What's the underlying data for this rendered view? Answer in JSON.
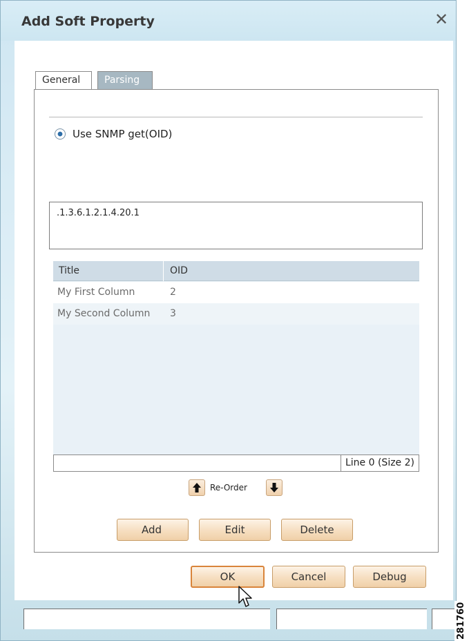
{
  "dialog": {
    "title": "Add Soft Property",
    "close_icon": "close-icon",
    "close_glyph": "✕"
  },
  "tabs": [
    {
      "label": "General",
      "selected": false
    },
    {
      "label": "Parsing",
      "selected": true
    }
  ],
  "parsing": {
    "radio_label": "Use SNMP get(OID)",
    "radio_selected": true,
    "oid_value": ".1.3.6.1.2.1.4.20.1"
  },
  "table": {
    "headers": [
      "Title",
      "OID"
    ],
    "rows": [
      [
        "My First Column",
        "2"
      ],
      [
        "My Second Column",
        "3"
      ]
    ],
    "status": "Line 0 (Size 2)"
  },
  "reorder": {
    "label": "Re-Order",
    "up_icon": "arrow-up-icon",
    "down_icon": "arrow-down-icon"
  },
  "row_buttons": {
    "add": "Add",
    "edit": "Edit",
    "delete": "Delete"
  },
  "dialog_buttons": {
    "ok": "OK",
    "cancel": "Cancel",
    "debug": "Debug"
  },
  "figure_id": "281760",
  "colors": {
    "window_bg": "#cfe6f2",
    "button_bg": "#f6dec0",
    "active_tab": "#a7b8c2",
    "focus_border": "#d9843a"
  }
}
